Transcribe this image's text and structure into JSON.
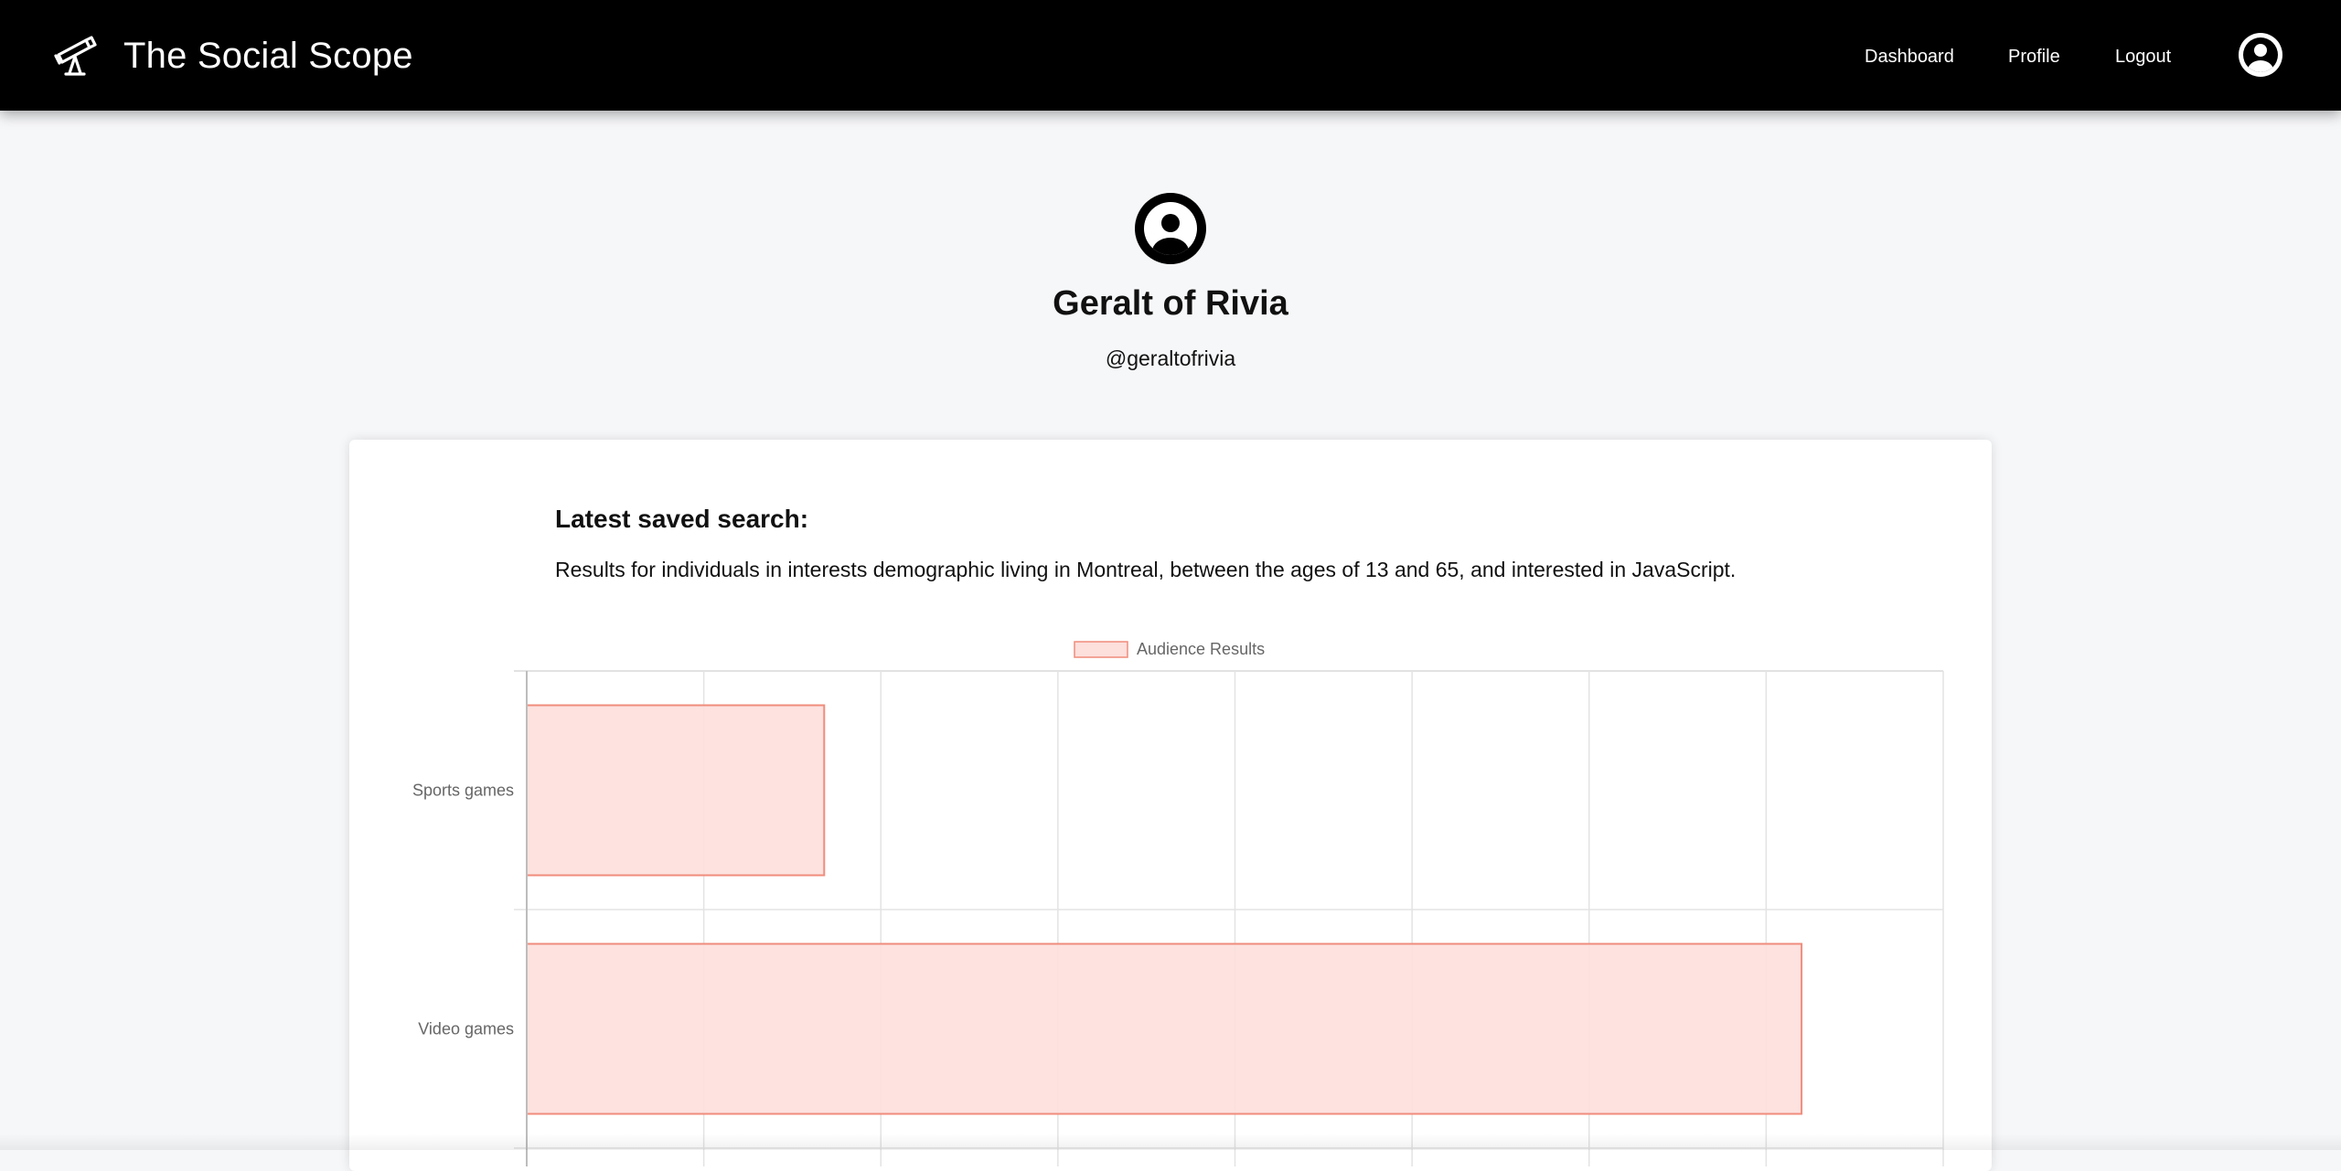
{
  "navbar": {
    "brand_title": "The Social Scope",
    "brand_icon": "telescope-icon",
    "links": [
      {
        "label": "Dashboard"
      },
      {
        "label": "Profile"
      },
      {
        "label": "Logout"
      }
    ],
    "avatar_icon": "user-circle-icon"
  },
  "profile": {
    "avatar_icon": "user-circle-icon",
    "name": "Geralt of Rivia",
    "handle": "@geraltofrivia"
  },
  "search": {
    "heading": "Latest saved search:",
    "description": "Results for individuals in interests demographic living in Montreal, between the ages of 13 and 65, and interested in JavaScript."
  },
  "chart_data": {
    "type": "bar",
    "orientation": "horizontal",
    "categories": [
      "Sports games",
      "Video games"
    ],
    "series": [
      {
        "name": "Audience Results",
        "values": [
          1.68,
          7.2
        ]
      }
    ],
    "xlim": [
      0,
      8
    ],
    "grid": true,
    "legend": "top-center",
    "colors": {
      "fill": "#fddfdc",
      "stroke": "#f08c7c"
    }
  }
}
